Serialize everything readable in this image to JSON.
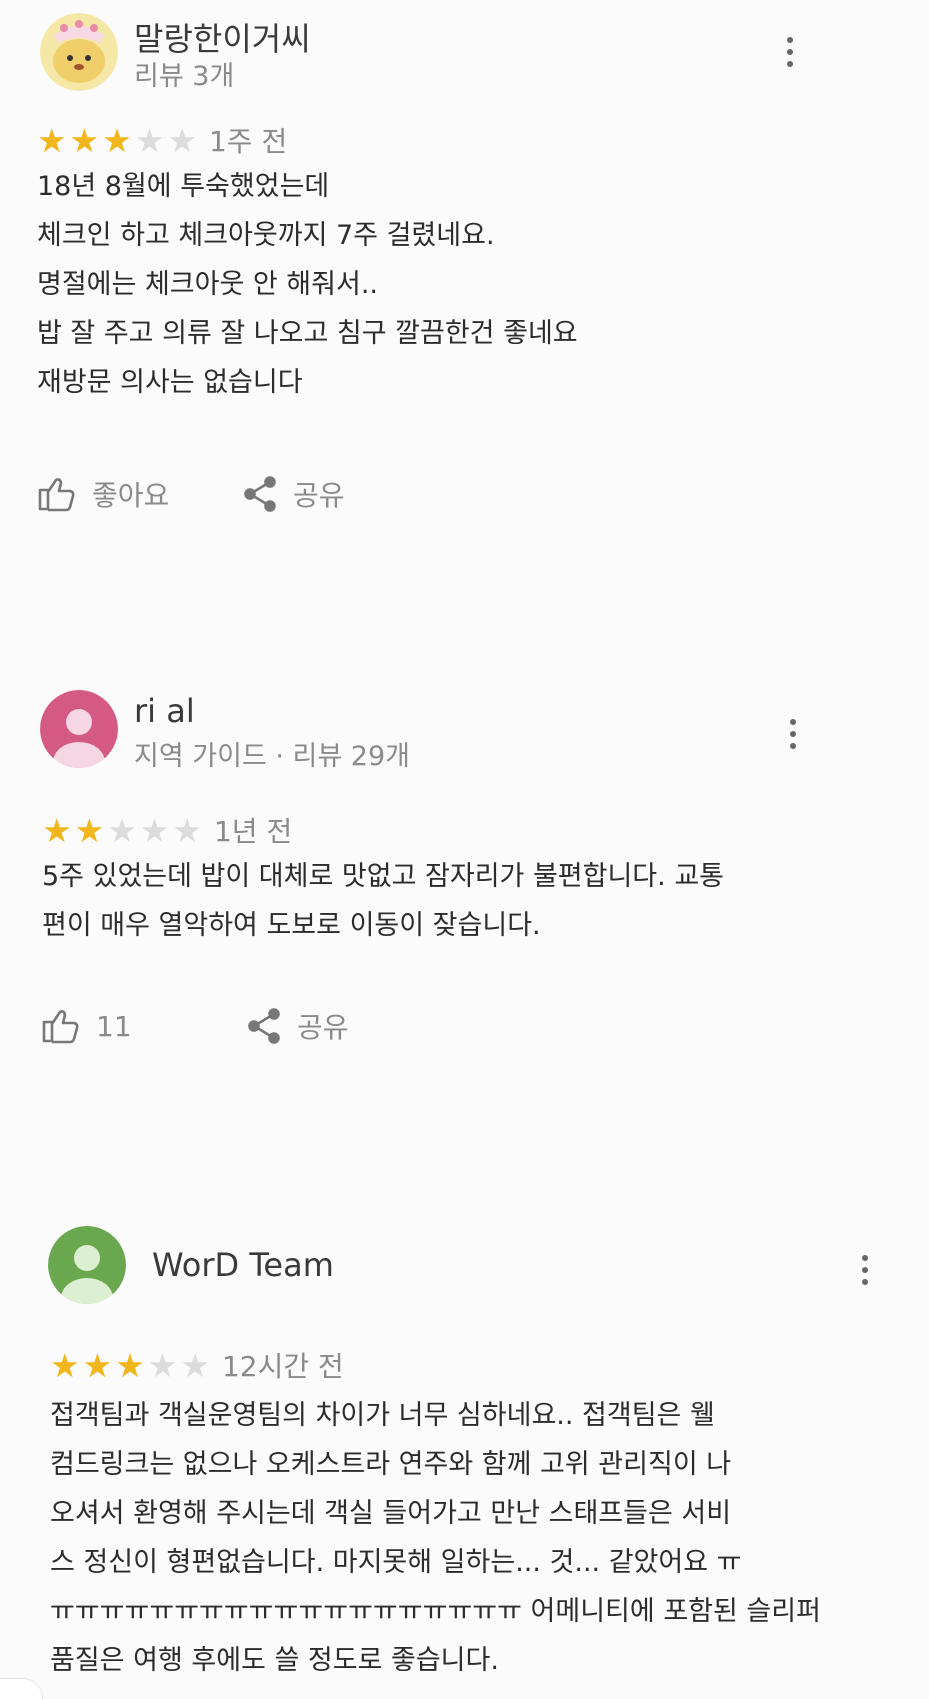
{
  "reviews": [
    {
      "author": "말랑한이거씨",
      "meta": "리뷰 3개",
      "rating": 3,
      "max_rating": 5,
      "time_ago": "1주 전",
      "text_lines": [
        "18년 8월에 투숙했었는데",
        "체크인 하고 체크아웃까지 7주 걸렸네요.",
        "명절에는 체크아웃 안 해줘서..",
        "밥 잘 주고 의류 잘 나오고 침구 깔끔한건 좋네요",
        "재방문 의사는 없습니다"
      ],
      "like_label": "좋아요",
      "share_label": "공유",
      "avatar_icon": "cartoon-avatar-icon",
      "avatar_color": "#f5e7a6"
    },
    {
      "author": "ri al",
      "meta": "지역 가이드 · 리뷰 29개",
      "rating": 2,
      "max_rating": 5,
      "time_ago": "1년 전",
      "text_lines": [
        "5주 있었는데 밥이 대체로 맛없고 잠자리가 불편합니다. 교통",
        "편이 매우 열악하여 도보로 이동이 잦습니다."
      ],
      "like_label": "11",
      "share_label": "공유",
      "avatar_icon": "person-avatar-icon",
      "avatar_color": "#d45a83"
    },
    {
      "author": "WorD Team",
      "meta": "",
      "rating": 3,
      "max_rating": 5,
      "time_ago": "12시간 전",
      "text_lines": [
        "접객팀과 객실운영팀의 차이가 너무 심하네요.. 접객팀은 웰",
        "컴드링크는 없으나 오케스트라 연주와 함께 고위 관리직이 나",
        "오셔서 환영해 주시는데 객실 들어가고 만난 스태프들은 서비",
        "스 정신이 형편없습니다. 마지못해 일하는... 것... 같았어요 ㅠ",
        "ㅠㅠㅠㅠㅠㅠㅠㅠㅠㅠㅠㅠㅠㅠㅠㅠㅠㅠㅠ 어메니티에 포함된 슬리퍼",
        "품질은 여행 후에도 쓸 정도로 좋습니다."
      ],
      "avatar_icon": "person-avatar-icon",
      "avatar_color": "#6aa84f"
    }
  ],
  "colors": {
    "star_filled": "#f1b61c",
    "star_empty": "#dcdcdc",
    "secondary_text": "#8a8a8a"
  }
}
